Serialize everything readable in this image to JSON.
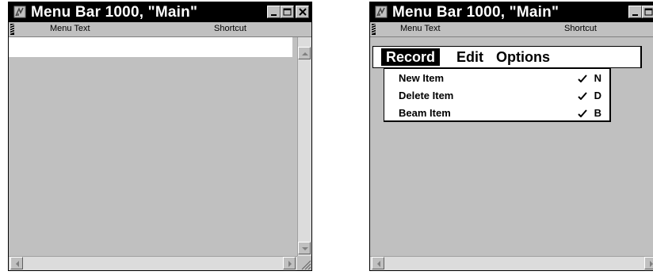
{
  "windows": [
    {
      "title": "Menu Bar 1000, \"Main\"",
      "columns": {
        "menu_text": "Menu Text",
        "shortcut": "Shortcut"
      }
    },
    {
      "title": "Menu Bar 1000, \"Main\"",
      "columns": {
        "menu_text": "Menu Text",
        "shortcut": "Shortcut"
      },
      "menu_bar": {
        "menus": [
          "Record",
          "Edit",
          "Options"
        ],
        "active_menu": "Record"
      },
      "dropdown": {
        "items": [
          {
            "label": "New Item",
            "shortcut_key": "N"
          },
          {
            "label": "Delete Item",
            "shortcut_key": "D"
          },
          {
            "label": "Beam Item",
            "shortcut_key": "B"
          }
        ]
      }
    }
  ],
  "icons": {
    "app": "resource-editor-icon",
    "minimize": "minimize-icon",
    "maximize": "maximize-icon",
    "close": "close-icon",
    "shortcut_stroke": "command-stroke-icon",
    "scroll_up": "arrow-up-icon",
    "scroll_down": "arrow-down-icon",
    "scroll_left": "arrow-left-icon",
    "scroll_right": "arrow-right-icon",
    "resize": "resize-grip-icon"
  }
}
